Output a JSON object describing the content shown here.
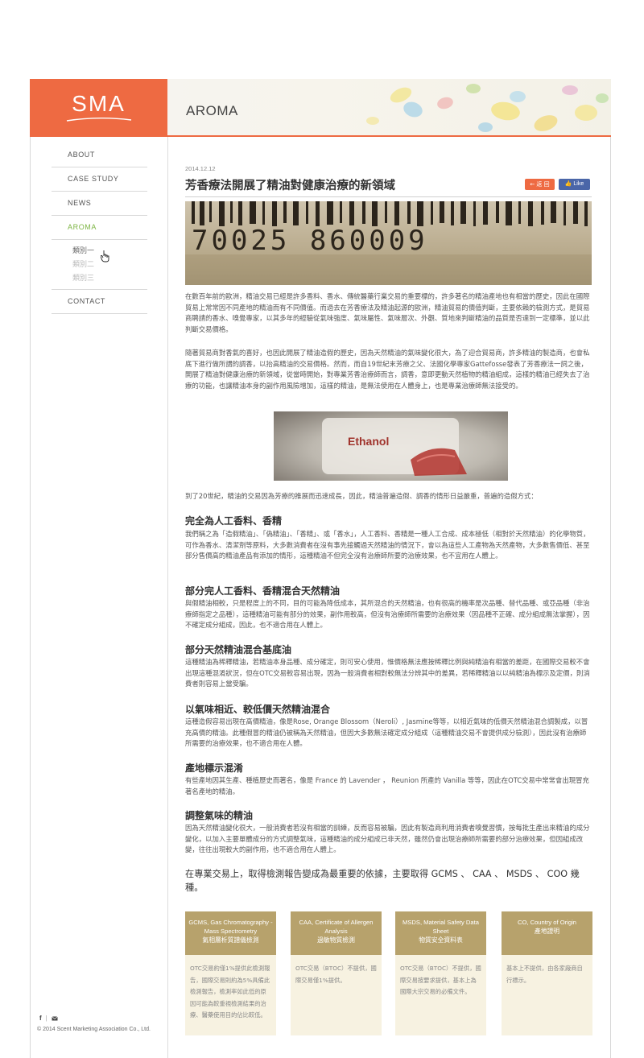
{
  "brand": {
    "logo": "SMA",
    "section_title": "AROMA",
    "accent": "#ee6a42",
    "active_nav": "#7db544"
  },
  "nav": {
    "items": [
      "ABOUT",
      "CASE STUDY",
      "NEWS",
      "AROMA"
    ],
    "sub_items": [
      "類別一",
      "類別二",
      "類別三"
    ],
    "contact": "CONTACT"
  },
  "footer": {
    "facebook_icon": "f",
    "divider": "|",
    "copyright": "© 2014 Scent Marketing Association Co., Ltd."
  },
  "article": {
    "date": "2014.12.12",
    "title": "芳香療法開展了精油對健康治療的新領域",
    "back_label": "← 返 回",
    "like_label": "👍 Like",
    "barcode_text": "70025 860009",
    "ethanol_text": "Ethanol",
    "p1": "在數百年前的歐洲，精油交易已經是許多香料、香水、傳統醫藥行業交易的重要標的，許多著名的精油產地也有相當的歷史，因此在國際貿易上常常因不同產地的精油而有不同價值。而過去在芳香療法及精油起源的歐洲，精油貿易的價值判斷，主要依賴的檢測方式，是貿易商聘請的香水、嗅覺專家，以其多年的經驗從氣味強度、氣味屬性、氣味層次、外觀、質地來判斷精油的品質是否達到一定標準，並以此判斷交易價格。",
    "p2": "隨著貿易商對香氣的喜好，也因此開展了精油造假的歷史，因為天然精油的氣味變化很大，為了迎合貿易商，許多精油的製造商，也會私底下進行做所謂的調香，以抬高精油的交易價格。然而，而自19世紀末芳療之父、法國化學專家Gattefosse發表了芳香療法一詞之後，開展了精油對健康治療的新領域，從當時開始，對專業芳香治療師而言，調香，意即更動天然植物的精油組成，這樣的精油已經失去了治療的功能，也讓精油本身的副作用風險增加，這樣的精油，是無法使用在人體身上，也是專業治療師無法接受的。",
    "p3": "到了20世紀，精油的交易因為芳療的推展而迅速成長，因此，精油普遍造假、調香的情形日益嚴重，普遍的造假方式：",
    "h1": "完全為人工香料、香精",
    "p4": "我們稱之為「造假精油」、「偽精油」、「香精」、或「香水」，人工香料、香精是一種人工合成、成本極低（相對於天然精油）的化學物質，可作為香水、清潔劑等原料，大多數消費者在沒有事先接觸過天然精油的情況下，會以為這些人工產物為天然產物，大多數售價低、甚至部分售價高的精油產品有添加的情形，這種精油不但完全沒有治療師所要的治療效果，也不宜用在人體上。",
    "h2": "部分完人工香料、香精混合天然精油",
    "p5": "與假精油相較，只是程度上的不同，目的可能為降低成本，其所混合的天然精油，也有很高的機率是次品種、替代品種、或亞品種（非治療師指定之品種），這種精油可能有部分的效果，副作用較高，但沒有治療師所需要的治療效果（因品種不正確、成分組成無法掌握），因不確定成分組成，因此，也不適合用在人體上。",
    "h3": "部分天然精油混合基底油",
    "p6": "這種精油為稀釋精油，若精油本身品種、成分確定，則可安心使用，惟價格無法應按稀釋比例與純精油有相當的差距，在國際交易較不會出現這種混淆狀況，但在OTC交易較容易出現，因為一般消費者相對較無法分辨其中的差異，若稀釋精油以以純精油為標示及定價，則消費者則容易上當受騙。",
    "h4": "以氣味相近、較低價天然精油混合",
    "p7": "這種造假容易出現在高價精油，像是Rose, Orange Blossom（Neroli）, Jasmine等等，以相近氣味的低價天然精油混合調製成，以冒充高價的精油。此種假冒的精油仍被稱為天然精油，但因大多數無法確定成分組成（這種精油交易不會提供成分檢測），因此沒有治療師所需要的治療效果，也不適合用在人體。",
    "h5": "產地標示混淆",
    "p8": "有些產地因其生產、種植歷史而著名，像是 France 的 Lavender ， Reunion 所產的 Vanilla 等等，因此在OTC交易中常常會出現冒充著名產地的精油。",
    "h6": "調整氣味的精油",
    "p9": "因為天然精油變化很大，一般消費者若沒有相當的訓練，反而容易被騙，因此有製造商利用消費者嗅覺習慣，按每批生產出來精油的成分變化，以加入主要單體成分的方式調整氣味，這種精油的成分組成已非天然，雖然仍會出現治療師所需要的部分治療效果，但因組成改變，往往出現較大的副作用，也不適合用在人體上。",
    "lead": "在專業交易上，取得檢測報告變成為最重要的依據，主要取得 GCMS 、 CAA 、 MSDS 、 COO 幾種。"
  },
  "cards": [
    {
      "title_en": "GCMS, Gas Chromatography - Mass Spectrometry",
      "title_zh": "氣相層析質譜儀檢測",
      "body": "OTC交易約僅1%提供此檢測報告，國際交易則約為5%具備此檢測報告，檢測率如此低的原因可能為較重視檢測結果的治療、醫藥使用目的佔比較低。"
    },
    {
      "title_en": "CAA, Certificate of Allergen Analysis",
      "title_zh": "過敏物質檢測",
      "body": "OTC交易（BTOC）不提供，國際交易僅1%提供。"
    },
    {
      "title_en": "MSDS, Material Safety Data Sheet",
      "title_zh": "物質安全資料表",
      "body": "OTC交易（BTOC）不提供，國際交易按要求提供，基本上為國際大宗交易的必備文件。"
    },
    {
      "title_en": "CO, Country of Origin",
      "title_zh": "產地證明",
      "body": "基本上不提供，由各家廠商自行標示。"
    }
  ]
}
